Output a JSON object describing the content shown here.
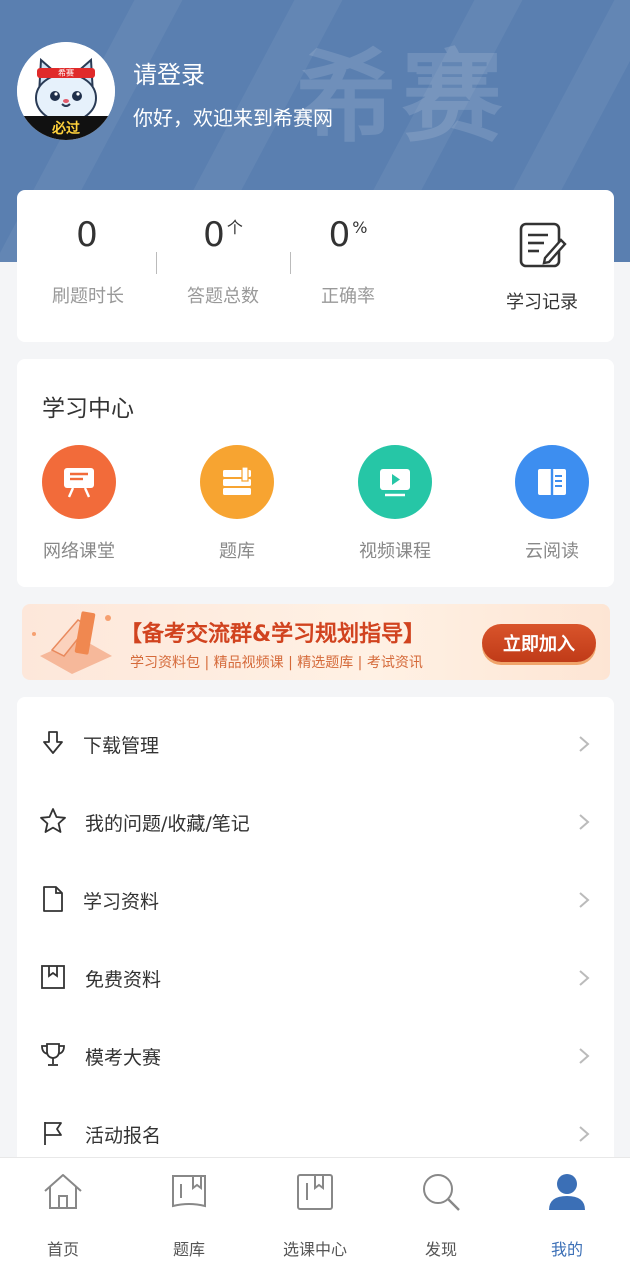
{
  "header": {
    "login_title": "请登录",
    "welcome": "你好，欢迎来到希赛网",
    "watermark": "希赛",
    "avatar_badge_top": "希赛",
    "avatar_badge_bottom": "必过",
    "bg_color": "#5a7fb0"
  },
  "stats": {
    "items": [
      {
        "value": "0",
        "unit": "",
        "label": "刷题时长"
      },
      {
        "value": "0",
        "unit": "个",
        "label": "答题总数"
      },
      {
        "value": "0",
        "unit": "%",
        "label": "正确率"
      }
    ],
    "record_label": "学习记录",
    "record_icon": "edit-note-icon"
  },
  "study_center": {
    "title": "学习中心",
    "tools": [
      {
        "label": "网络课堂",
        "icon": "classroom-icon",
        "color": "#f26b3a"
      },
      {
        "label": "题库",
        "icon": "question-bank-icon",
        "color": "#f7a431"
      },
      {
        "label": "视频课程",
        "icon": "video-icon",
        "color": "#26c6a6"
      },
      {
        "label": "云阅读",
        "icon": "book-icon",
        "color": "#3d8ef0"
      }
    ]
  },
  "banner": {
    "title": "【备考交流群&学习规划指导】",
    "subtitle": "学习资料包 | 精品视频课 | 精选题库 | 考试资讯",
    "button": "立即加入"
  },
  "menu": [
    {
      "label": "下载管理",
      "icon": "download-icon"
    },
    {
      "label": "我的问题/收藏/笔记",
      "icon": "star-icon"
    },
    {
      "label": "学习资料",
      "icon": "document-icon"
    },
    {
      "label": "免费资料",
      "icon": "bookmark-icon"
    },
    {
      "label": "模考大赛",
      "icon": "trophy-icon"
    },
    {
      "label": "活动报名",
      "icon": "flag-icon"
    }
  ],
  "tabbar": {
    "tabs": [
      {
        "label": "首页",
        "icon": "home-icon"
      },
      {
        "label": "题库",
        "icon": "question-bank-icon"
      },
      {
        "label": "选课中心",
        "icon": "course-icon"
      },
      {
        "label": "发现",
        "icon": "search-icon"
      },
      {
        "label": "我的",
        "icon": "user-icon"
      }
    ],
    "active": "我的",
    "active_color": "#3b6fb6"
  }
}
